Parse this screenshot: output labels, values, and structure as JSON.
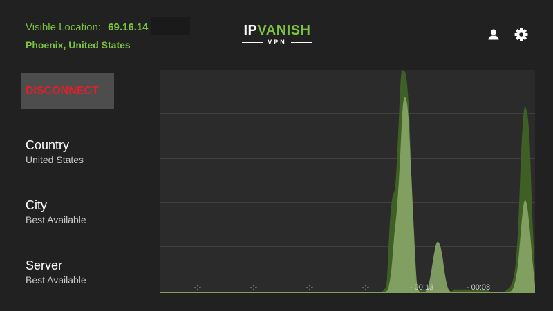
{
  "header": {
    "visible_location_label": "Visible Location:",
    "visible_ip": "69.16.14",
    "visible_city": "Phoenix, United States"
  },
  "logo": {
    "ip": "IP",
    "vanish": "VANISH",
    "vpn": "VPN"
  },
  "icons": {
    "account": "person-icon",
    "settings": "gear-icon"
  },
  "disconnect_label": "DISCONNECT",
  "info": {
    "country_label": "Country",
    "country_value": "United States",
    "city_label": "City",
    "city_value": "Best Available",
    "server_label": "Server",
    "server_value": "Best Available"
  },
  "colors": {
    "accent": "#7cc242",
    "danger": "#e0202a",
    "background": "#212121",
    "chart_background": "#2b2b2b",
    "series_dark": "#3f5f24",
    "series_light": "#8aa86a"
  },
  "chart_data": {
    "type": "area",
    "x_tick_labels": [
      "-:-",
      "-:-",
      "-:-",
      "-:-",
      "- 00:13",
      "- 00:08"
    ],
    "ylim": [
      0,
      100
    ],
    "grid": true,
    "series": [
      {
        "color": "#3f5f24",
        "values": [
          0,
          0,
          0,
          0,
          0,
          0,
          0,
          0,
          0,
          0,
          0,
          0,
          0,
          0,
          0,
          0,
          0,
          0,
          0,
          0,
          0,
          0,
          0,
          0,
          0,
          0,
          0,
          0,
          0,
          0,
          0,
          0,
          0,
          0,
          0,
          0,
          0,
          0,
          0,
          0,
          0,
          0,
          0,
          0,
          0,
          0,
          0,
          0,
          0,
          0,
          0,
          0,
          0,
          0,
          0,
          0,
          0,
          0,
          0,
          0,
          0,
          0,
          0,
          0,
          0,
          0,
          0,
          0,
          0,
          0,
          0,
          0,
          0,
          0,
          0,
          0,
          0,
          0,
          0,
          0,
          1,
          5,
          30,
          43,
          48,
          70,
          97,
          100,
          97,
          80,
          45,
          10,
          2,
          1,
          1,
          1,
          1,
          1,
          1,
          1,
          1,
          1,
          1,
          1,
          0,
          1,
          1,
          1,
          1,
          1,
          1,
          1,
          1,
          1,
          1,
          1,
          1,
          1,
          0,
          0,
          0,
          0,
          0,
          0,
          1,
          2,
          5,
          12,
          30,
          62,
          82,
          82,
          70,
          35,
          8
        ]
      },
      {
        "color": "#8aa86a",
        "values": [
          0,
          0,
          0,
          0,
          0,
          0,
          0,
          0,
          0,
          0,
          0,
          0,
          0,
          0,
          0,
          0,
          0,
          0,
          0,
          0,
          0,
          0,
          0,
          0,
          0,
          0,
          0,
          0,
          0,
          0,
          0,
          0,
          0,
          0,
          0,
          0,
          0,
          0,
          0,
          0,
          0,
          0,
          0,
          0,
          0,
          0,
          0,
          0,
          0,
          0,
          0,
          0,
          0,
          0,
          0,
          0,
          0,
          0,
          0,
          0,
          0,
          0,
          0,
          0,
          0,
          0,
          0,
          0,
          0,
          0,
          0,
          0,
          0,
          0,
          0,
          0,
          0,
          0,
          0,
          0,
          0,
          2,
          10,
          25,
          38,
          58,
          83,
          88,
          80,
          55,
          28,
          5,
          0,
          0,
          0,
          2,
          8,
          16,
          22,
          22,
          17,
          8,
          2,
          0,
          0,
          0,
          0,
          0,
          0,
          0,
          0,
          0,
          0,
          0,
          0,
          0,
          0,
          0,
          0,
          0,
          0,
          0,
          0,
          0,
          0,
          1,
          5,
          13,
          28,
          40,
          40,
          30,
          15,
          3
        ]
      }
    ]
  }
}
